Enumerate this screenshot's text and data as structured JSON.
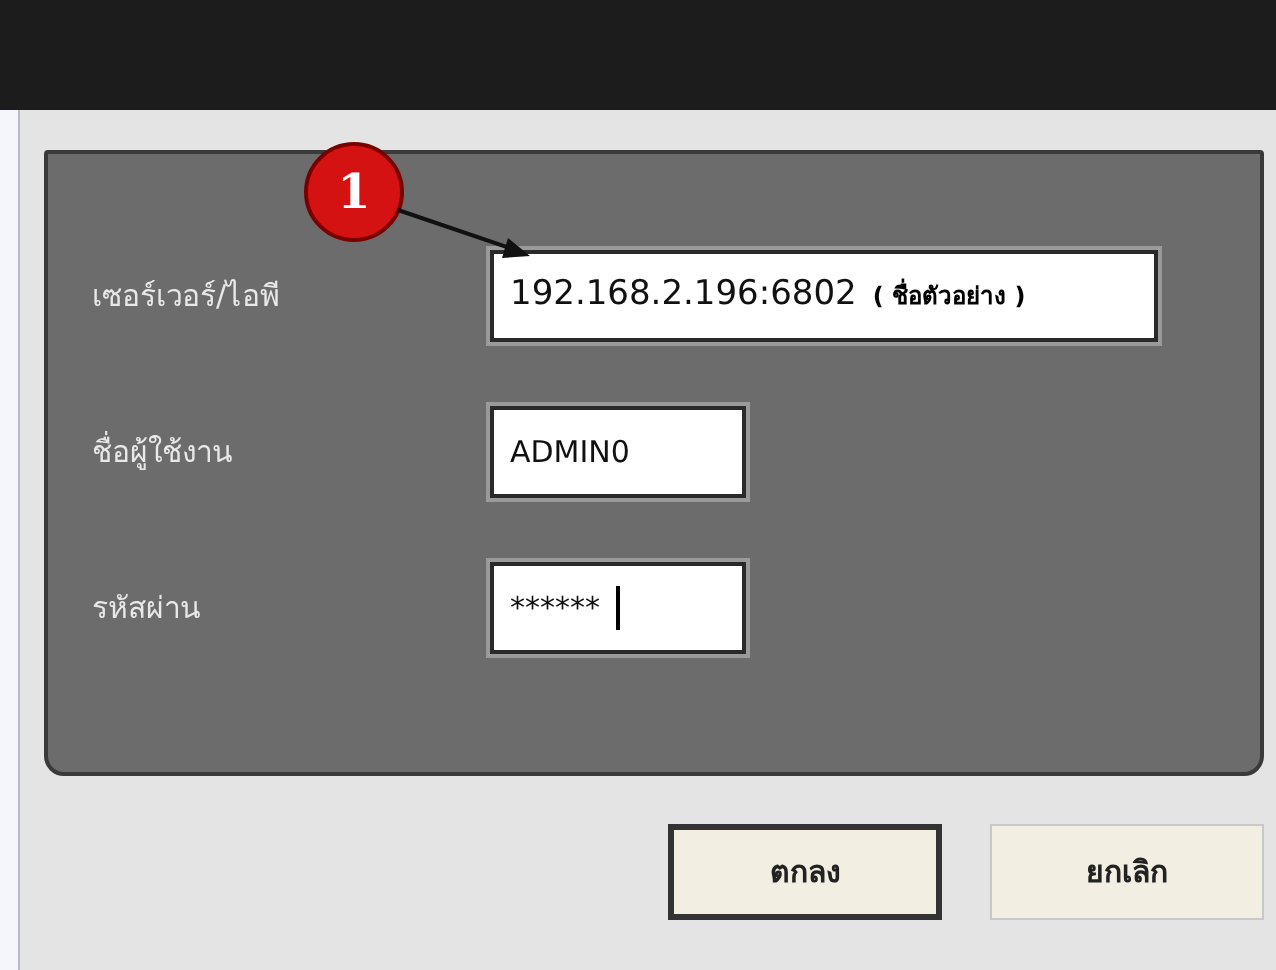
{
  "callout": {
    "number": "1"
  },
  "fields": [
    {
      "label": "เซอร์เวอร์/ไอพี",
      "value": "192.168.2.196:6802",
      "hint": "( ชื่อตัวอย่าง )",
      "kind": "wide"
    },
    {
      "label": "ชื่อผู้ใช้งาน",
      "value": "ADMIN0",
      "kind": "short"
    },
    {
      "label": "รหัสผ่าน",
      "value": "******",
      "kind": "password"
    }
  ],
  "buttons": [
    {
      "label": "ตกลง",
      "default": true
    },
    {
      "label": "ยกเลิก",
      "default": false
    }
  ]
}
